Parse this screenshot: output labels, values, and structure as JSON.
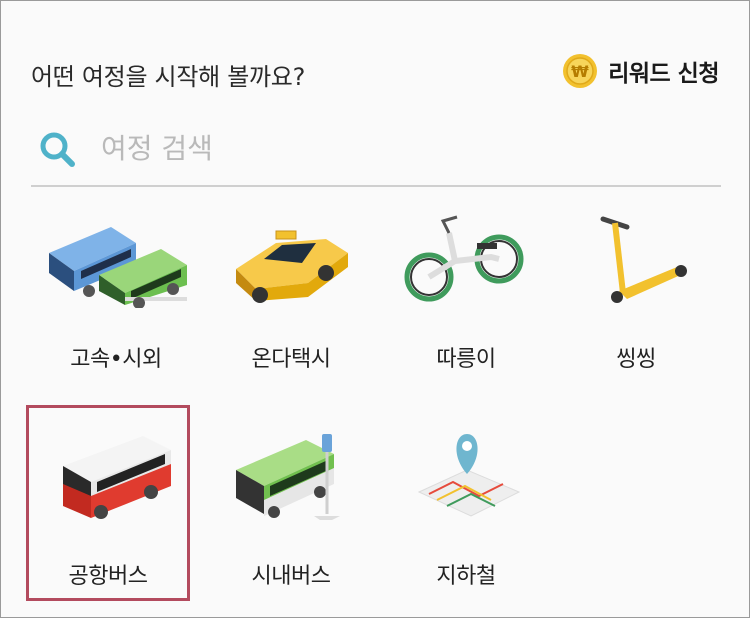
{
  "header": {
    "question": "어떤 여정을 시작해 볼까요?",
    "reward_label": "리워드 신청",
    "coin_symbol": "₩"
  },
  "search": {
    "placeholder": "여정 검색",
    "value": ""
  },
  "modes": [
    {
      "label": "고속•시외",
      "icon": "intercity-bus-icon"
    },
    {
      "label": "온다택시",
      "icon": "taxi-icon"
    },
    {
      "label": "따릉이",
      "icon": "bicycle-icon"
    },
    {
      "label": "씽씽",
      "icon": "kick-scooter-icon"
    },
    {
      "label": "공항버스",
      "icon": "airport-bus-icon",
      "selected": true
    },
    {
      "label": "시내버스",
      "icon": "city-bus-icon"
    },
    {
      "label": "지하철",
      "icon": "subway-map-icon"
    }
  ],
  "colors": {
    "selection_border": "#b34b5e",
    "coin": "#f2c12e",
    "search_icon": "#4fb2c9"
  }
}
